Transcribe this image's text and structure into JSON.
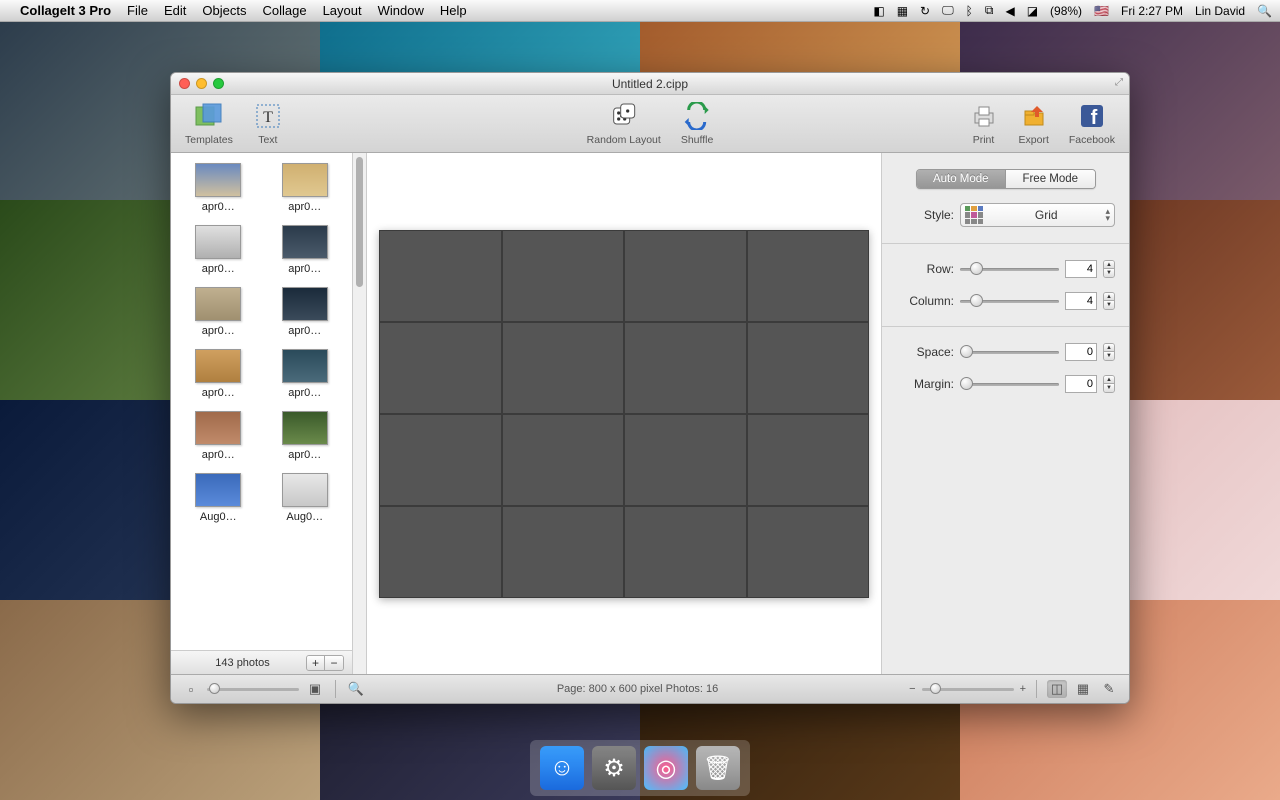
{
  "menubar": {
    "app": "CollageIt 3 Pro",
    "items": [
      "File",
      "Edit",
      "Objects",
      "Collage",
      "Layout",
      "Window",
      "Help"
    ],
    "battery": "(98%)",
    "time": "Fri 2:27 PM",
    "user": "Lin David"
  },
  "window": {
    "title": "Untitled 2.cipp"
  },
  "toolbar": {
    "templates": "Templates",
    "text": "Text",
    "random": "Random Layout",
    "shuffle": "Shuffle",
    "print": "Print",
    "export": "Export",
    "facebook": "Facebook"
  },
  "sidebar": {
    "thumbs": [
      {
        "label": "apr0…"
      },
      {
        "label": "apr0…"
      },
      {
        "label": "apr0…"
      },
      {
        "label": "apr0…"
      },
      {
        "label": "apr0…"
      },
      {
        "label": "apr0…"
      },
      {
        "label": "apr0…"
      },
      {
        "label": "apr0…"
      },
      {
        "label": "apr0…"
      },
      {
        "label": "apr0…"
      },
      {
        "label": "Aug0…"
      },
      {
        "label": "Aug0…"
      }
    ],
    "count": "143 photos"
  },
  "panel": {
    "mode": {
      "auto": "Auto Mode",
      "free": "Free Mode",
      "active": "auto"
    },
    "style_label": "Style:",
    "style_value": "Grid",
    "row_label": "Row:",
    "row_value": "4",
    "col_label": "Column:",
    "col_value": "4",
    "space_label": "Space:",
    "space_value": "0",
    "margin_label": "Margin:",
    "margin_value": "0"
  },
  "bottom": {
    "page_info": "Page: 800 x 600 pixel Photos: 16",
    "minus": "−",
    "plus": "+"
  }
}
